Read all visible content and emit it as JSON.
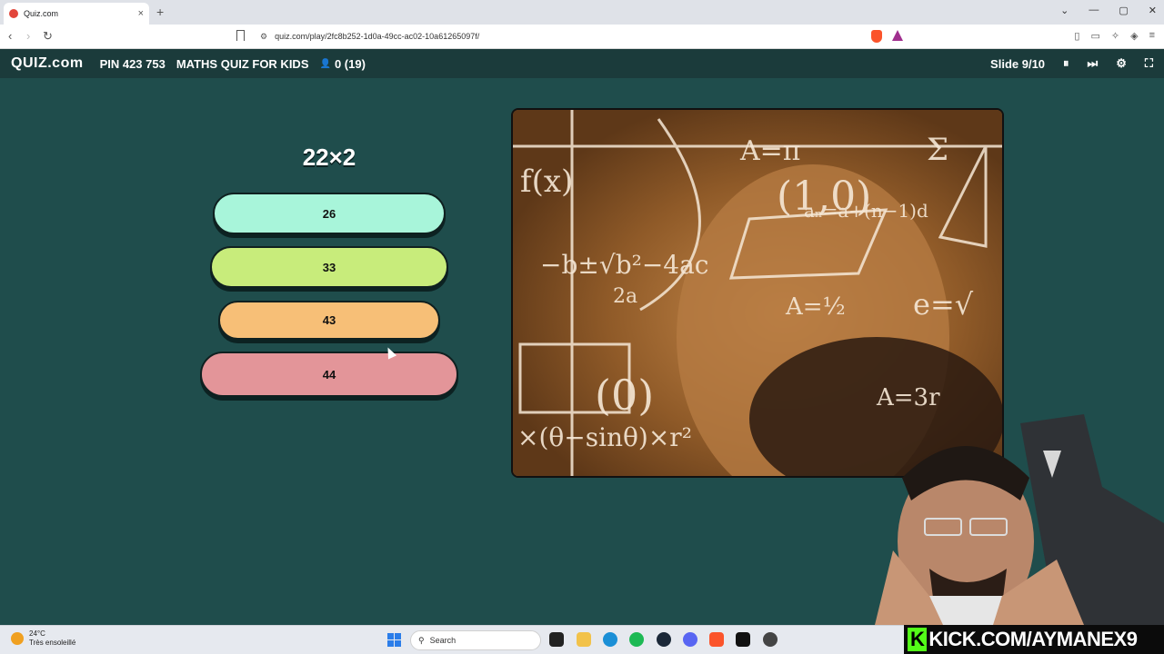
{
  "browser": {
    "tab_title": "Quiz.com",
    "tab_close": "×",
    "new_tab": "+",
    "url": "quiz.com/play/2fc8b252-1d0a-49cc-ac02-10a61265097f/",
    "nav": {
      "back": "‹",
      "forward": "›",
      "reload": "↻"
    },
    "window": {
      "dropdown": "⌄",
      "minimize": "—",
      "maximize": "▢",
      "close": "✕"
    }
  },
  "appbar": {
    "logo_main": "QUIZ",
    "logo_suffix": ".com",
    "pin": "PIN 423 753",
    "quiz_title": "MATHS QUIZ FOR KIDS",
    "players": "0 (19)",
    "slide": "Slide 9/10",
    "pause": "⏸",
    "skip": "⏭",
    "settings": "⚙",
    "fullscreen": "⛶"
  },
  "question": {
    "text": "22×2",
    "answers": [
      "26",
      "33",
      "43",
      "44"
    ]
  },
  "taskbar": {
    "temperature": "24°C",
    "condition": "Très ensoleillé",
    "search_placeholder": "Search"
  },
  "overlay": {
    "kick_prefix": "K",
    "kick_text": "KICK.COM/AYMANEX9"
  },
  "colors": {
    "answer_1": "#a8f5da",
    "answer_2": "#c8ec7b",
    "answer_3": "#f7bf77",
    "answer_4": "#e39599",
    "background": "#1f4d4c",
    "kick_green": "#53fc18"
  }
}
